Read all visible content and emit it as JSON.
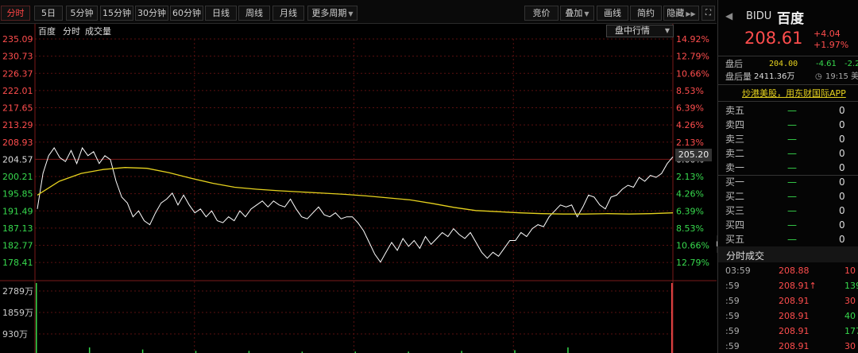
{
  "toolbar": {
    "left_tabs": [
      "分时",
      "5日",
      "5分钟",
      "15分钟",
      "30分钟",
      "60分钟",
      "日线",
      "周线",
      "月线",
      "更多周期"
    ],
    "right_buttons": [
      "竞价",
      "叠加",
      "画线",
      "简约",
      "隐藏"
    ]
  },
  "chart": {
    "legend": [
      "百度",
      "分时",
      "成交量"
    ],
    "mode_select": "盘中行情",
    "current_price_tag": "205.20",
    "colors": {
      "price_line": "#ffffff",
      "avg_line": "#e6d21e",
      "grid": "#5a1010",
      "up": "#ff4d4d",
      "down": "#37d94d"
    }
  },
  "chart_data": {
    "type": "line",
    "price_axis": [
      "235.09",
      "230.73",
      "226.37",
      "222.01",
      "217.65",
      "213.29",
      "208.93",
      "204.57",
      "200.21",
      "195.85",
      "191.49",
      "187.13",
      "182.77",
      "178.41"
    ],
    "pct_axis": [
      "14.92%",
      "12.79%",
      "10.66%",
      "8.53%",
      "6.39%",
      "4.26%",
      "2.13%",
      "0.00%",
      "2.13%",
      "4.26%",
      "6.39%",
      "8.53%",
      "10.66%",
      "12.79%"
    ],
    "volume_axis": [
      "2789万",
      "1859万",
      "930万"
    ],
    "ylim": [
      178.41,
      235.09
    ],
    "series": [
      {
        "values": [
          192,
          201,
          205.5,
          207.5,
          205,
          204,
          206.8,
          203.5,
          207.5,
          205.5,
          206.5,
          203.5,
          205.5,
          204.5,
          199,
          195,
          193.5,
          190,
          191.5,
          189,
          188,
          191,
          193.5,
          194.5,
          196,
          193,
          195.5,
          193,
          191,
          192,
          190,
          191.5,
          189,
          188.5,
          190,
          189,
          191.5,
          190,
          192,
          193,
          194,
          192.5,
          194,
          193,
          192.5,
          194.5,
          192,
          190,
          189.5,
          191,
          192.5,
          190.5,
          190,
          191,
          189.5,
          190,
          190,
          188.5,
          186.5,
          183.5,
          180.5,
          178.5,
          181,
          183.5,
          181.5,
          184.5,
          182.5,
          184,
          182,
          185,
          183,
          184.5,
          186,
          185,
          187,
          185.5,
          184.5,
          186,
          183.5,
          181,
          179.5,
          181,
          180,
          182,
          184,
          184,
          186,
          185,
          187,
          188,
          187.5,
          190,
          191.5,
          193,
          192.5,
          193,
          190,
          192.5,
          195.5,
          195,
          193,
          192,
          195,
          195.5,
          197,
          198,
          197.5,
          200,
          199,
          200.5,
          200,
          201,
          203.5,
          205.2
        ],
        "color": "#ffffff"
      },
      {
        "values": [
          195.5,
          199,
          201,
          202,
          202.5,
          202.3,
          201.2,
          199.8,
          198.5,
          197.5,
          197,
          196.6,
          196.3,
          196,
          195.7,
          195.3,
          194.8,
          194.3,
          193.4,
          192.4,
          191.6,
          191.3,
          191,
          190.8,
          190.7,
          190.7,
          190.8,
          190.7,
          190.8,
          191
        ],
        "color": "#e6d21e"
      }
    ],
    "volume": [
      1.0,
      0.08,
      0.05,
      0.03,
      0.03,
      0.02,
      0.02,
      0.02,
      0.03,
      0.04,
      0.08,
      1.0
    ]
  },
  "panel": {
    "ticker": "BIDU",
    "name": "百度",
    "price": "208.61",
    "change": "+4.04",
    "change_pct": "+1.97%",
    "after_label": "盘后",
    "after_price": "204.00",
    "after_change": "-4.61",
    "after_pct": "-2.2",
    "after_vol_label": "盘后量",
    "after_vol": "2411.36万",
    "time": "19:15 美",
    "ad": "炒港美股，用东财国际APP",
    "sell_labels": [
      "卖五",
      "卖四",
      "卖三",
      "卖二",
      "卖一"
    ],
    "buy_labels": [
      "买一",
      "买二",
      "买三",
      "买四",
      "买五"
    ],
    "dash": "—",
    "zero": "0",
    "trade_title": "分时成交",
    "trades": [
      {
        "t": "03:59",
        "p": "208.88",
        "v": "10",
        "vc": "#ff4d4d"
      },
      {
        "t": ":59",
        "p": "208.91",
        "v": "139",
        "vc": "#37d94d",
        "up": "↑"
      },
      {
        "t": ":59",
        "p": "208.91",
        "v": "30",
        "vc": "#ff4d4d"
      },
      {
        "t": ":59",
        "p": "208.91",
        "v": "40",
        "vc": "#37d94d"
      },
      {
        "t": ":59",
        "p": "208.91",
        "v": "177",
        "vc": "#37d94d"
      },
      {
        "t": ":59",
        "p": "208.91",
        "v": "30",
        "vc": "#ff4d4d"
      }
    ]
  }
}
